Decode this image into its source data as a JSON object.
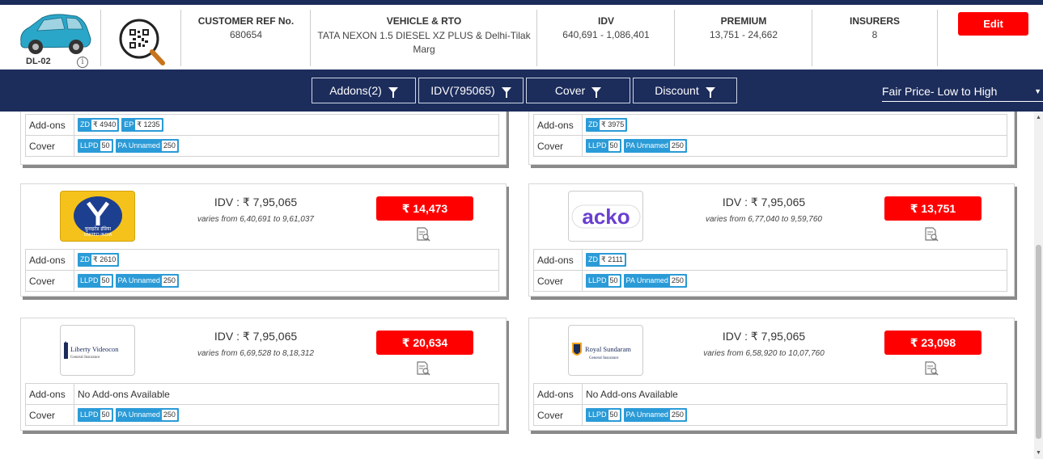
{
  "header": {
    "car_code": "DL-02",
    "customer_ref_label": "CUSTOMER REF No.",
    "customer_ref_value": "680654",
    "vehicle_label": "VEHICLE & RTO",
    "vehicle_value": "TATA NEXON 1.5 DIESEL XZ PLUS & Delhi-Tilak Marg",
    "idv_label": "IDV",
    "idv_value": "640,691 - 1,086,401",
    "premium_label": "PREMIUM",
    "premium_value": "13,751 - 24,662",
    "insurers_label": "INSURERS",
    "insurers_value": "8",
    "edit_label": "Edit"
  },
  "filters": {
    "addons": "Addons(2)",
    "idv": "IDV(795065)",
    "cover": "Cover",
    "discount": "Discount",
    "sort": "Fair Price- Low to High"
  },
  "labels": {
    "addons": "Add-ons",
    "cover": "Cover",
    "no_addons": "No Add-ons Available"
  },
  "cards": [
    {
      "addons": [
        {
          "k": "ZD",
          "v": "₹ 4940"
        },
        {
          "k": "EP",
          "v": "₹ 1235"
        }
      ],
      "cover": [
        {
          "k": "LLPD",
          "v": "50"
        },
        {
          "k": "PA Unnamed",
          "v": "250"
        }
      ]
    },
    {
      "addons": [
        {
          "k": "ZD",
          "v": "₹ 3975"
        }
      ],
      "cover": [
        {
          "k": "LLPD",
          "v": "50"
        },
        {
          "k": "PA Unnamed",
          "v": "250"
        }
      ]
    },
    {
      "insurer": "United India",
      "idv": "IDV : ₹ 7,95,065",
      "varies": "varies from 6,40,691 to 9,61,037",
      "price": "₹ 14,473",
      "addons": [
        {
          "k": "ZD",
          "v": "₹ 2610"
        }
      ],
      "cover": [
        {
          "k": "LLPD",
          "v": "50"
        },
        {
          "k": "PA Unnamed",
          "v": "250"
        }
      ]
    },
    {
      "insurer": "Acko",
      "idv": "IDV : ₹ 7,95,065",
      "varies": "varies from 6,77,040 to 9,59,760",
      "price": "₹ 13,751",
      "addons": [
        {
          "k": "ZD",
          "v": "₹ 2111"
        }
      ],
      "cover": [
        {
          "k": "LLPD",
          "v": "50"
        },
        {
          "k": "PA Unnamed",
          "v": "250"
        }
      ]
    },
    {
      "insurer": "Liberty Videocon",
      "idv": "IDV : ₹ 7,95,065",
      "varies": "varies from 6,69,528 to 8,18,312",
      "price": "₹ 20,634",
      "addons": [],
      "cover": [
        {
          "k": "LLPD",
          "v": "50"
        },
        {
          "k": "PA Unnamed",
          "v": "250"
        }
      ]
    },
    {
      "insurer": "Royal Sundaram",
      "idv": "IDV : ₹ 7,95,065",
      "varies": "varies from 6,58,920 to 10,07,760",
      "price": "₹ 23,098",
      "addons": [],
      "cover": [
        {
          "k": "LLPD",
          "v": "50"
        },
        {
          "k": "PA Unnamed",
          "v": "250"
        }
      ]
    }
  ],
  "logos": {
    "united_india": "युनाइटेड इंडिया",
    "united_india_en": "UNITED INDIA",
    "acko": "acko",
    "liberty_1": "Liberty Videocon",
    "liberty_2": "General Insurance",
    "royal_1": "Royal Sundaram",
    "royal_2": "General Insurance"
  },
  "icons": {
    "car": "car-icon",
    "qr": "qr-search-icon",
    "info": "info-icon",
    "filter": "funnel-icon",
    "doc": "document-search-icon"
  },
  "colors": {
    "navy": "#1c2c5b",
    "red": "#ff0000",
    "tag_blue": "#2b9bd7"
  }
}
